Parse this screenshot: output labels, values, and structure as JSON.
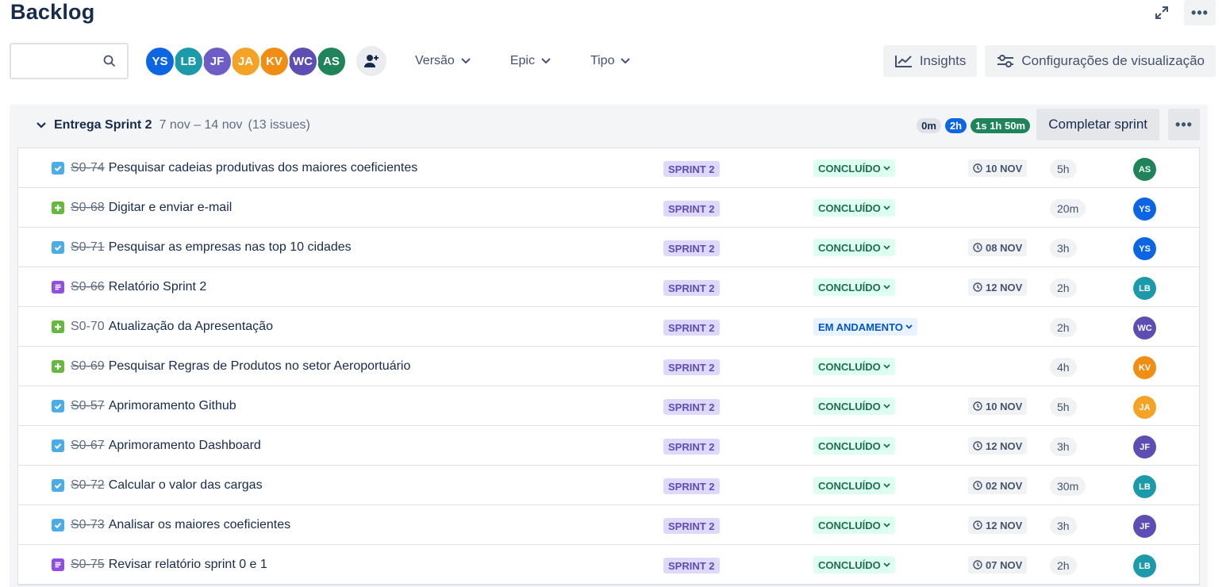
{
  "page": {
    "title": "Backlog"
  },
  "search": {
    "placeholder": "",
    "value": ""
  },
  "avatars": [
    {
      "initials": "YS",
      "color": "#0c66e4"
    },
    {
      "initials": "LB",
      "color": "#1d9aaa"
    },
    {
      "initials": "JF",
      "color": "#6e5dc6"
    },
    {
      "initials": "JA",
      "color": "#f5a326"
    },
    {
      "initials": "KV",
      "color": "#f18d13"
    },
    {
      "initials": "WC",
      "color": "#5e4db2"
    },
    {
      "initials": "AS",
      "color": "#1f845a"
    }
  ],
  "filters": {
    "version": "Versão",
    "epic": "Epic",
    "type": "Tipo"
  },
  "tools": {
    "insights": "Insights",
    "view_settings": "Configurações de visualização"
  },
  "sprint": {
    "name": "Entrega Sprint 2",
    "dates": "7 nov – 14 nov",
    "count": "(13 issues)",
    "estimates": {
      "todo": "0m",
      "in_progress": "2h",
      "done": "1s 1h 50m"
    },
    "complete_label": "Completar sprint",
    "issues": [
      {
        "type": "task",
        "key": "S0-74",
        "summary": "Pesquisar cadeias produtivas dos maiores coeficientes",
        "sprint": "SPRINT 2",
        "status": "CONCLUÍDO",
        "due": "10 NOV",
        "estimate": "5h",
        "assignee": "AS",
        "assignee_color": "#1f845a",
        "done": true
      },
      {
        "type": "subtask",
        "key": "S0-68",
        "summary": "Digitar e enviar e-mail",
        "sprint": "SPRINT 2",
        "status": "CONCLUÍDO",
        "due": "",
        "estimate": "20m",
        "assignee": "YS",
        "assignee_color": "#0c66e4",
        "done": true
      },
      {
        "type": "task",
        "key": "S0-71",
        "summary": "Pesquisar as empresas nas top 10 cidades",
        "sprint": "SPRINT 2",
        "status": "CONCLUÍDO",
        "due": "08 NOV",
        "estimate": "3h",
        "assignee": "YS",
        "assignee_color": "#0c66e4",
        "done": true
      },
      {
        "type": "story",
        "key": "S0-66",
        "summary": "Relatório Sprint 2",
        "sprint": "SPRINT 2",
        "status": "CONCLUÍDO",
        "due": "12 NOV",
        "estimate": "2h",
        "assignee": "LB",
        "assignee_color": "#1d9aaa",
        "done": true
      },
      {
        "type": "subtask",
        "key": "S0-70",
        "summary": "Atualização da Apresentação",
        "sprint": "SPRINT 2",
        "status": "EM ANDAMENTO",
        "due": "",
        "estimate": "2h",
        "assignee": "WC",
        "assignee_color": "#5e4db2",
        "done": false
      },
      {
        "type": "subtask",
        "key": "S0-69",
        "summary": "Pesquisar Regras de Produtos no setor Aeroportuário",
        "sprint": "SPRINT 2",
        "status": "CONCLUÍDO",
        "due": "",
        "estimate": "4h",
        "assignee": "KV",
        "assignee_color": "#f18d13",
        "done": true
      },
      {
        "type": "task",
        "key": "S0-57",
        "summary": "Aprimoramento Github",
        "sprint": "SPRINT 2",
        "status": "CONCLUÍDO",
        "due": "10 NOV",
        "estimate": "5h",
        "assignee": "JA",
        "assignee_color": "#f5a326",
        "done": true
      },
      {
        "type": "task",
        "key": "S0-67",
        "summary": "Aprimoramento Dashboard",
        "sprint": "SPRINT 2",
        "status": "CONCLUÍDO",
        "due": "12 NOV",
        "estimate": "3h",
        "assignee": "JF",
        "assignee_color": "#5e4db2",
        "done": true
      },
      {
        "type": "task",
        "key": "S0-72",
        "summary": "Calcular o valor das cargas",
        "sprint": "SPRINT 2",
        "status": "CONCLUÍDO",
        "due": "02 NOV",
        "estimate": "30m",
        "assignee": "LB",
        "assignee_color": "#1d9aaa",
        "done": true
      },
      {
        "type": "task",
        "key": "S0-73",
        "summary": "Analisar os maiores coeficientes",
        "sprint": "SPRINT 2",
        "status": "CONCLUÍDO",
        "due": "12 NOV",
        "estimate": "3h",
        "assignee": "JF",
        "assignee_color": "#5e4db2",
        "done": true
      },
      {
        "type": "story",
        "key": "S0-75",
        "summary": "Revisar relatório sprint 0 e 1",
        "sprint": "SPRINT 2",
        "status": "CONCLUÍDO",
        "due": "07 NOV",
        "estimate": "2h",
        "assignee": "LB",
        "assignee_color": "#1d9aaa",
        "done": true
      }
    ]
  },
  "colors": {
    "task": "#4bade8",
    "subtask": "#63ba3c",
    "story": "#904ee2",
    "accent": "#0c66e4"
  }
}
